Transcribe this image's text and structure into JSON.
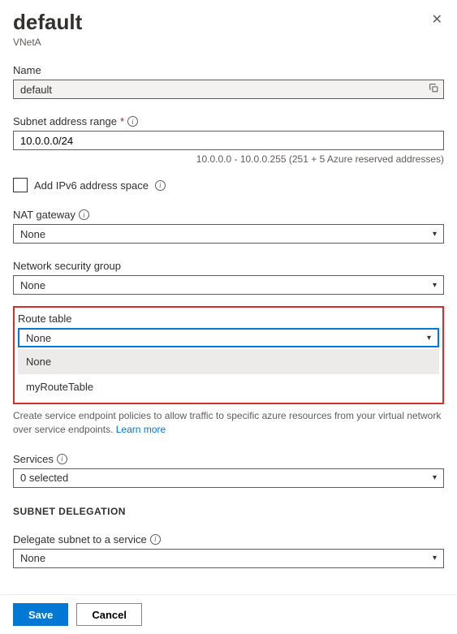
{
  "header": {
    "title": "default",
    "subtitle": "VNetA"
  },
  "name": {
    "label": "Name",
    "value": "default"
  },
  "subnetAddressRange": {
    "label": "Subnet address range",
    "value": "10.0.0.0/24",
    "helper": "10.0.0.0 - 10.0.0.255 (251 + 5 Azure reserved addresses)"
  },
  "ipv6": {
    "label": "Add IPv6 address space"
  },
  "natGateway": {
    "label": "NAT gateway",
    "value": "None"
  },
  "nsg": {
    "label": "Network security group",
    "value": "None"
  },
  "routeTable": {
    "label": "Route table",
    "value": "None",
    "options": [
      "None",
      "myRouteTable"
    ]
  },
  "serviceEndpoints": {
    "helper": "Create service endpoint policies to allow traffic to specific azure resources from your virtual network over service endpoints.",
    "learnMore": "Learn more",
    "servicesLabel": "Services",
    "servicesValue": "0 selected"
  },
  "subnetDelegation": {
    "header": "SUBNET DELEGATION",
    "label": "Delegate subnet to a service",
    "value": "None"
  },
  "footer": {
    "save": "Save",
    "cancel": "Cancel"
  }
}
